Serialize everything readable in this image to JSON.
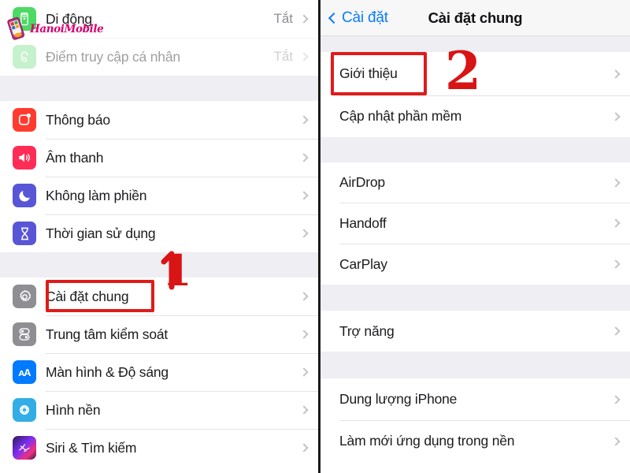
{
  "left_panel": {
    "groups": [
      {
        "rows": [
          {
            "label": "Di động",
            "value": "Tắt",
            "icon": "cellular-icon",
            "dim": false
          },
          {
            "label": "Điểm truy cập cá nhân",
            "value": "Tắt",
            "icon": "hotspot-icon",
            "dim": true
          }
        ]
      },
      {
        "rows": [
          {
            "label": "Thông báo",
            "value": "",
            "icon": "notifications-icon",
            "dim": false
          },
          {
            "label": "Âm thanh",
            "value": "",
            "icon": "sounds-icon",
            "dim": false
          },
          {
            "label": "Không làm phiền",
            "value": "",
            "icon": "do-not-disturb-icon",
            "dim": false
          },
          {
            "label": "Thời gian sử dụng",
            "value": "",
            "icon": "screen-time-icon",
            "dim": false
          }
        ]
      },
      {
        "rows": [
          {
            "label": "Cài đặt chung",
            "value": "",
            "icon": "general-settings-icon",
            "dim": false
          },
          {
            "label": "Trung tâm kiểm soát",
            "value": "",
            "icon": "control-center-icon",
            "dim": false
          },
          {
            "label": "Màn hình & Độ sáng",
            "value": "",
            "icon": "display-brightness-icon",
            "dim": false
          },
          {
            "label": "Hình nền",
            "value": "",
            "icon": "wallpaper-icon",
            "dim": false
          },
          {
            "label": "Siri & Tìm kiếm",
            "value": "",
            "icon": "siri-icon",
            "dim": false
          }
        ]
      }
    ]
  },
  "right_panel": {
    "navbar": {
      "back_label": "Cài đặt",
      "title": "Cài đặt chung"
    },
    "groups": [
      {
        "rows": [
          {
            "label": "Giới thiệu"
          },
          {
            "label": "Cập nhật phần mềm"
          }
        ]
      },
      {
        "rows": [
          {
            "label": "AirDrop"
          },
          {
            "label": "Handoff"
          },
          {
            "label": "CarPlay"
          }
        ]
      },
      {
        "rows": [
          {
            "label": "Trợ năng"
          }
        ]
      },
      {
        "rows": [
          {
            "label": "Dung lượng iPhone"
          },
          {
            "label": "Làm mới ứng dụng trong nền"
          }
        ]
      }
    ]
  },
  "watermark": {
    "text": "HanoiMobile"
  },
  "annotations": {
    "step_one": "1",
    "step_two": "2",
    "highlight_color": "#e01b1b"
  }
}
